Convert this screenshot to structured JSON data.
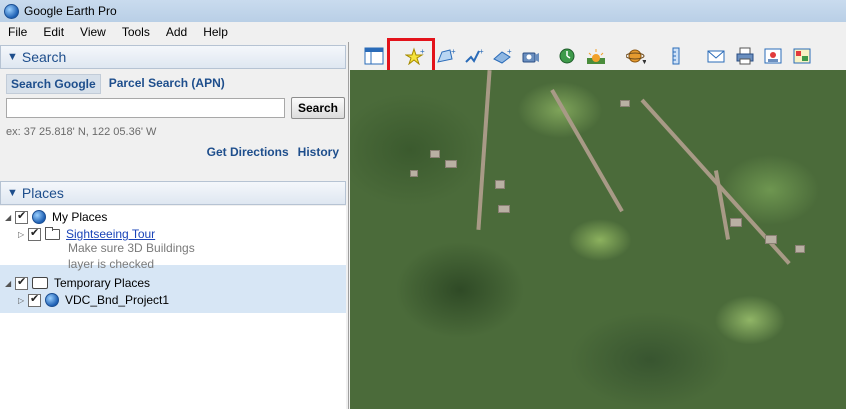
{
  "window": {
    "title": "Google Earth Pro"
  },
  "menu": [
    "File",
    "Edit",
    "View",
    "Tools",
    "Add",
    "Help"
  ],
  "search": {
    "header": "Search",
    "tabs": [
      "Search Google",
      "Parcel Search (APN)"
    ],
    "input_value": "",
    "button": "Search",
    "example": "ex: 37 25.818' N, 122 05.36' W",
    "links": [
      "Get Directions",
      "History"
    ]
  },
  "places": {
    "header": "Places",
    "my_places": "My Places",
    "tour": "Sightseeing Tour",
    "tour_desc_1": "Make sure 3D Buildings",
    "tour_desc_2": "layer is checked",
    "temporary": "Temporary Places",
    "project": "VDC_Bnd_Project1"
  },
  "toolbar": {
    "icons": [
      "sidebar-icon",
      "placemark-icon",
      "polygon-icon",
      "path-icon",
      "overlay-icon",
      "record-tour-icon",
      "historical-imagery-icon",
      "sunlight-icon",
      "planets-icon",
      "ruler-icon",
      "email-icon",
      "print-icon",
      "save-image-icon",
      "view-in-maps-icon"
    ],
    "highlighted": "placemark-icon",
    "highlight_color": "#e3131b"
  }
}
